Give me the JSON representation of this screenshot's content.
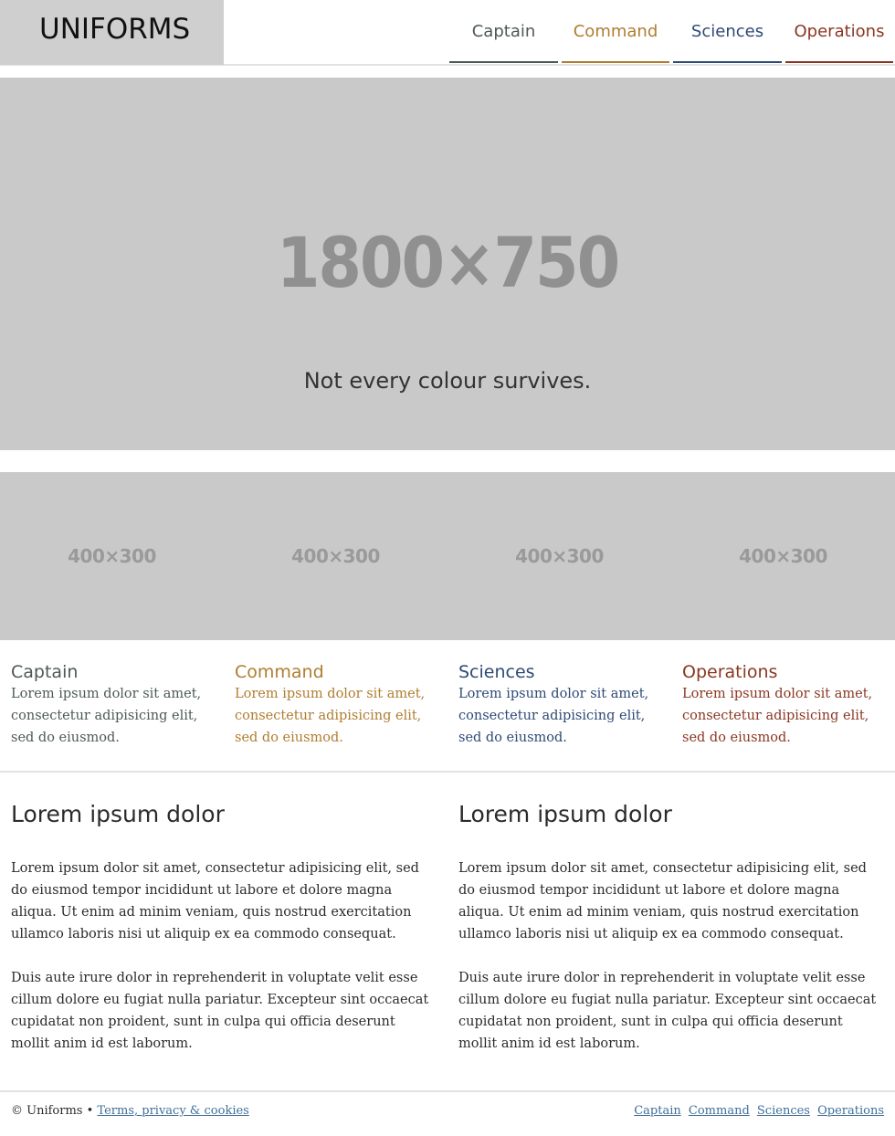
{
  "header": {
    "logo": "UNIFORMS",
    "nav": [
      {
        "label": "Captain",
        "color": "#4c5a55"
      },
      {
        "label": "Command",
        "color": "#b07d30"
      },
      {
        "label": "Sciences",
        "color": "#2e4a75"
      },
      {
        "label": "Operations",
        "color": "#8a3722"
      }
    ]
  },
  "hero": {
    "image_dims": "1800×750",
    "tagline": "Not every colour survives."
  },
  "thumbnails": [
    {
      "dims": "400×300"
    },
    {
      "dims": "400×300"
    },
    {
      "dims": "400×300"
    },
    {
      "dims": "400×300"
    }
  ],
  "divisions": [
    {
      "title": "Captain",
      "text": "Lorem ipsum dolor sit amet, consectetur adipisicing elit, sed do eiusmod."
    },
    {
      "title": "Command",
      "text": "Lorem ipsum dolor sit amet, consectetur adipisicing elit, sed do eiusmod."
    },
    {
      "title": "Sciences",
      "text": "Lorem ipsum dolor sit amet, consectetur adipisicing elit, sed do eiusmod."
    },
    {
      "title": "Operations",
      "text": "Lorem ipsum dolor sit amet, consectetur adipisicing elit, sed do eiusmod."
    }
  ],
  "articles": [
    {
      "title": "Lorem ipsum dolor",
      "p1": "Lorem ipsum dolor sit amet, consectetur adipisicing elit, sed do eiusmod tempor incididunt ut labore et dolore magna aliqua. Ut enim ad minim veniam, quis nostrud exercitation ullamco laboris nisi ut aliquip ex ea commodo consequat.",
      "p2": "Duis aute irure dolor in reprehenderit in voluptate velit esse cillum dolore eu fugiat nulla pariatur. Excepteur sint occaecat cupidatat non proident, sunt in culpa qui officia deserunt mollit anim id est laborum."
    },
    {
      "title": "Lorem ipsum dolor",
      "p1": "Lorem ipsum dolor sit amet, consectetur adipisicing elit, sed do eiusmod tempor incididunt ut labore et dolore magna aliqua. Ut enim ad minim veniam, quis nostrud exercitation ullamco laboris nisi ut aliquip ex ea commodo consequat.",
      "p2": "Duis aute irure dolor in reprehenderit in voluptate velit esse cillum dolore eu fugiat nulla pariatur. Excepteur sint occaecat cupidatat non proident, sunt in culpa qui officia deserunt mollit anim id est laborum."
    }
  ],
  "footer": {
    "copyright": "© Uniforms •",
    "terms_link": "Terms, privacy & cookies",
    "links": [
      "Captain",
      "Command",
      "Sciences",
      "Operations"
    ],
    "link_color": "#3f6f9a"
  }
}
